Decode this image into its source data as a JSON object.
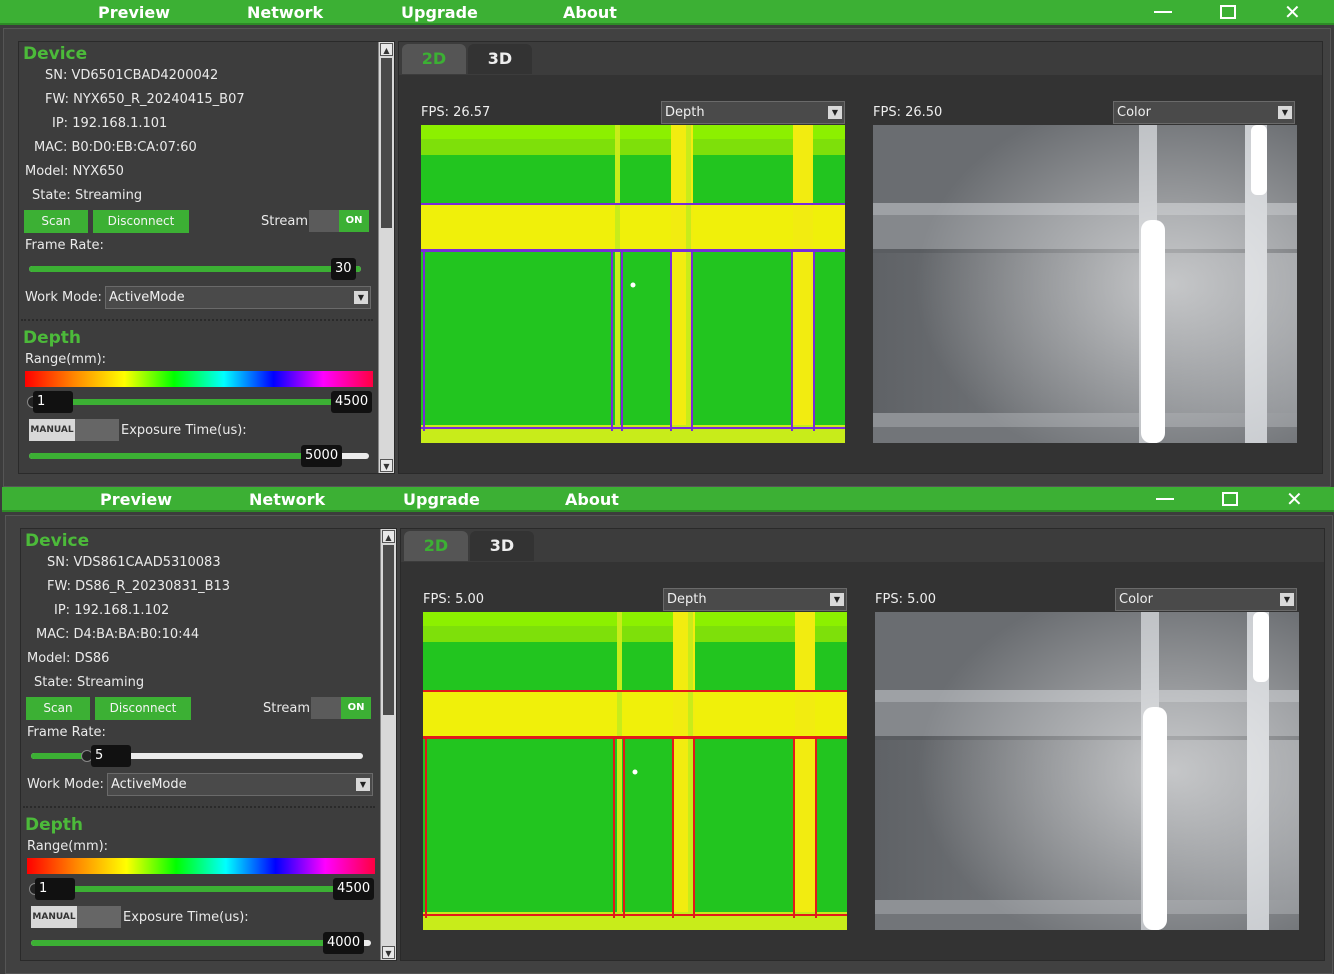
{
  "menu": [
    "Preview",
    "Network",
    "Upgrade",
    "About"
  ],
  "window_controls": [
    "minimize-icon",
    "maximize-icon",
    "close-icon"
  ],
  "labels": {
    "device": "Device",
    "depth": "Depth",
    "sn": "SN:",
    "fw": "FW:",
    "ip": "IP:",
    "mac": "MAC:",
    "model": "Model:",
    "state": "State:",
    "scan": "Scan",
    "disconnect": "Disconnect",
    "stream": "Stream:",
    "on": "ON",
    "frame_rate": "Frame Rate:",
    "work_mode": "Work Mode:",
    "range": "Range(mm):",
    "manual": "MANUAL",
    "exposure": "Exposure Time(us):",
    "tab_2d": "2D",
    "tab_3d": "3D",
    "fps": "FPS:"
  },
  "devices": [
    {
      "sn": "VD6501CBAD4200042",
      "fw": "NYX650_R_20240415_B07",
      "ip": "192.168.1.101",
      "mac": "B0:D0:EB:CA:07:60",
      "model": "NYX650",
      "state": "Streaming",
      "frame_rate": "30",
      "frame_rate_fraction": 1.0,
      "work_mode": "ActiveMode",
      "range_min": "1",
      "range_max": "4500",
      "exposure": "5000",
      "exposure_fraction": 0.94,
      "depth_fps": "26.57",
      "depth_mode": "Depth",
      "color_fps": "26.50",
      "color_mode": "Color"
    },
    {
      "sn": "VDS861CAAD5310083",
      "fw": "DS86_R_20230831_B13",
      "ip": "192.168.1.102",
      "mac": "D4:BA:BA:B0:10:44",
      "model": "DS86",
      "state": "Streaming",
      "frame_rate": "5",
      "frame_rate_fraction": 0.17,
      "work_mode": "ActiveMode",
      "range_min": "1",
      "range_max": "4500",
      "exposure": "4000",
      "exposure_fraction": 1.0,
      "depth_fps": "5.00",
      "depth_mode": "Depth",
      "color_fps": "5.00",
      "color_mode": "Color"
    }
  ]
}
